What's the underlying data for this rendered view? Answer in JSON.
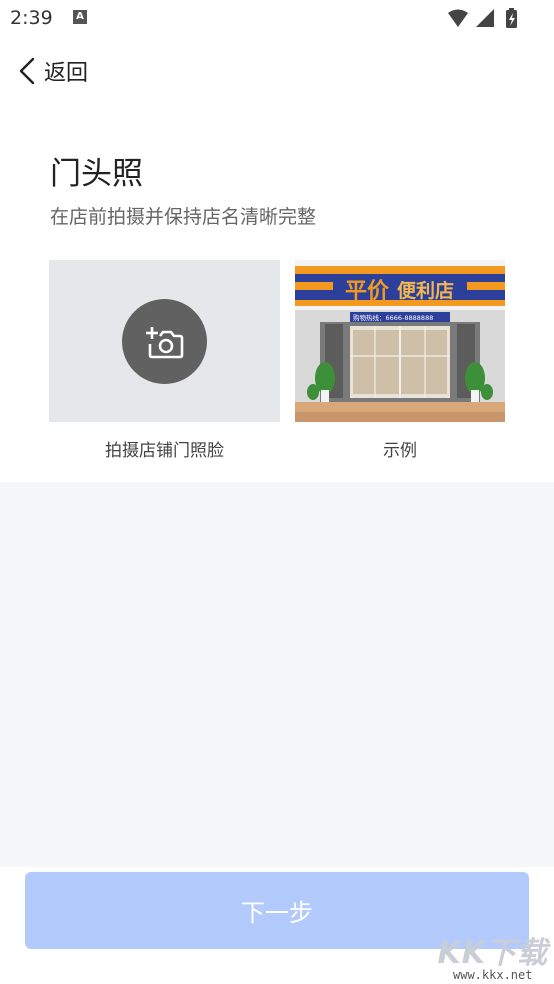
{
  "status_bar": {
    "time": "2:39",
    "notification_glyph": "A",
    "icons": [
      "wifi-icon",
      "signal-icon",
      "battery-icon"
    ]
  },
  "nav": {
    "back_label": "返回",
    "icon": "chevron-left-icon"
  },
  "section": {
    "title": "门头照",
    "description": "在店前拍摄并保持店名清晰完整"
  },
  "upload": {
    "label": "拍摄店铺门照脸",
    "icon": "add-camera-icon"
  },
  "example": {
    "label": "示例",
    "sign_main": "平价",
    "sign_accent": "便利店",
    "phone_banner": "购物热线：6666-8888888"
  },
  "footer": {
    "next_label": "下一步"
  },
  "watermark": {
    "main": "KK下载",
    "sub": "www.kkx.net"
  },
  "colors": {
    "primary_disabled": "#b2cbfc",
    "camera_bg": "#616161",
    "upload_bg": "#e6e7eb",
    "page_bg": "#f6f7f9"
  }
}
